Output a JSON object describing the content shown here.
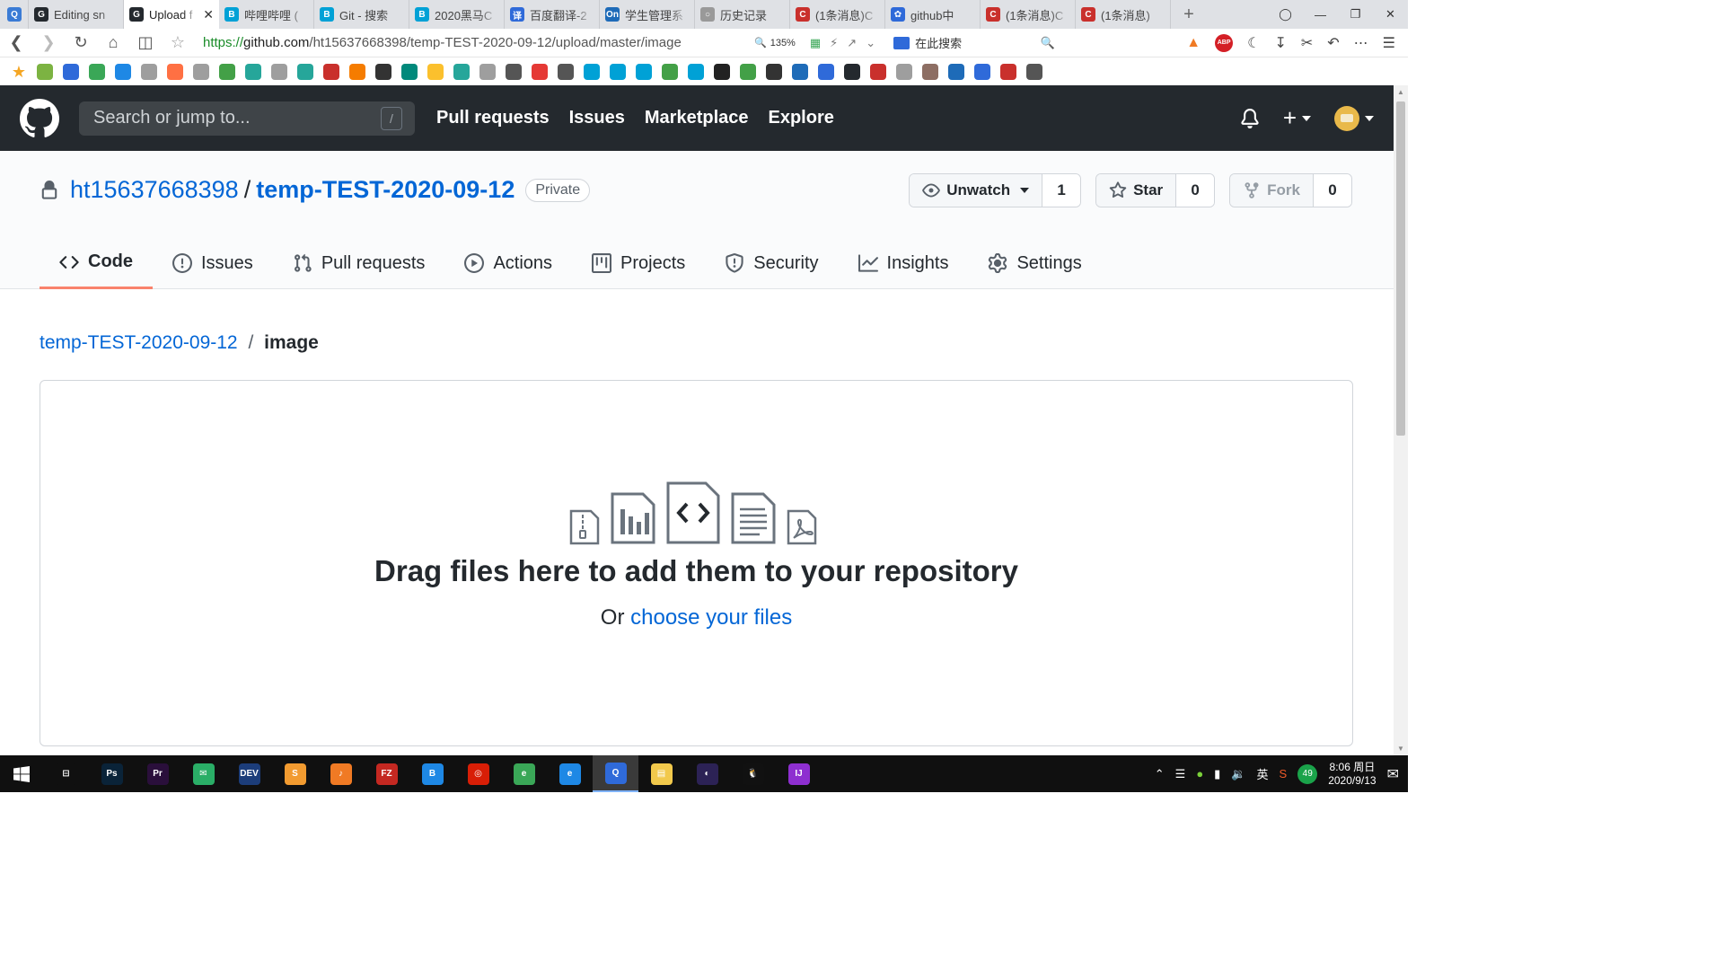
{
  "browser": {
    "tabs": [
      {
        "title": "",
        "color": "#3a7bd5",
        "glyph": "Q"
      },
      {
        "title": "Editing sn",
        "color": "#24292e",
        "glyph": "G"
      },
      {
        "title": "Upload f",
        "color": "#24292e",
        "glyph": "G",
        "active": true
      },
      {
        "title": "哔哩哔哩 (",
        "color": "#00a1d6",
        "glyph": "B"
      },
      {
        "title": "Git - 搜索",
        "color": "#00a1d6",
        "glyph": "B"
      },
      {
        "title": "2020黑马C",
        "color": "#00a1d6",
        "glyph": "B"
      },
      {
        "title": "百度翻译-2",
        "color": "#2f6ad9",
        "glyph": "译"
      },
      {
        "title": "学生管理系",
        "color": "#1e6bb8",
        "glyph": "On"
      },
      {
        "title": "历史记录",
        "color": "#999999",
        "glyph": "○"
      },
      {
        "title": "(1条消息)C",
        "color": "#c9302c",
        "glyph": "C"
      },
      {
        "title": "github中",
        "color": "#2f6ad9",
        "glyph": "✿"
      },
      {
        "title": "(1条消息)C",
        "color": "#c9302c",
        "glyph": "C"
      },
      {
        "title": "(1条消息)",
        "color": "#c9302c",
        "glyph": "C"
      }
    ],
    "close_glyph": "✕",
    "new_tab_glyph": "+",
    "url_scheme": "https://",
    "url_host": "github.com",
    "url_path": "/ht15637668398/temp-TEST-2020-09-12/upload/master/image",
    "zoom": "135%",
    "search_placeholder": "在此搜索"
  },
  "bookmarks": [
    "#f5a623",
    "#7cb342",
    "#2f6ad9",
    "#3aa757",
    "#1e88e5",
    "#9e9e9e",
    "#ff7043",
    "#9e9e9e",
    "#43a047",
    "#26a69a",
    "#9e9e9e",
    "#26a69a",
    "#c9302c",
    "#f57c00",
    "#333333",
    "#00897b",
    "#fbc02d",
    "#26a69a",
    "#9e9e9e",
    "#555555",
    "#e53935",
    "#555555",
    "#00a1d6",
    "#00a1d6",
    "#00a1d6",
    "#43a047",
    "#00a1d6",
    "#222222",
    "#43a047",
    "#333333",
    "#1e6bb8",
    "#2f6ad9",
    "#24292e",
    "#c9302c",
    "#9e9e9e",
    "#8d6e63",
    "#1e6bb8",
    "#2f6ad9",
    "#c9302c",
    "#555555"
  ],
  "github": {
    "search_placeholder": "Search or jump to...",
    "slash": "/",
    "nav": [
      "Pull requests",
      "Issues",
      "Marketplace",
      "Explore"
    ]
  },
  "repo": {
    "owner": "ht15637668398",
    "separator": "/",
    "name": "temp-TEST-2020-09-12",
    "visibility": "Private",
    "watch_label": "Unwatch",
    "watch_count": "1",
    "star_label": "Star",
    "star_count": "0",
    "fork_label": "Fork",
    "fork_count": "0",
    "tabs": [
      "Code",
      "Issues",
      "Pull requests",
      "Actions",
      "Projects",
      "Security",
      "Insights",
      "Settings"
    ],
    "active_tab": "Code"
  },
  "breadcrumb": {
    "repo": "temp-TEST-2020-09-12",
    "separator": "/",
    "dir": "image"
  },
  "dropzone": {
    "title": "Drag files here to add them to your repository",
    "or": "Or",
    "link": "choose your files"
  },
  "taskbar": {
    "apps": [
      {
        "name": "task-view",
        "color": "#101010",
        "glyph": "⊟"
      },
      {
        "name": "photoshop",
        "color": "#0a2338",
        "glyph": "Ps"
      },
      {
        "name": "premiere",
        "color": "#2a0f3b",
        "glyph": "Pr"
      },
      {
        "name": "wechat",
        "color": "#2aae67",
        "glyph": "✉"
      },
      {
        "name": "dev-cpp",
        "color": "#1c3d7a",
        "glyph": "DEV"
      },
      {
        "name": "sublime",
        "color": "#f29b30",
        "glyph": "S"
      },
      {
        "name": "qq-music",
        "color": "#f07a24",
        "glyph": "♪"
      },
      {
        "name": "filezilla",
        "color": "#c42821",
        "glyph": "FZ"
      },
      {
        "name": "bilibili",
        "color": "#1e88e5",
        "glyph": "B"
      },
      {
        "name": "netease-music",
        "color": "#d81e06",
        "glyph": "◎"
      },
      {
        "name": "browser-green",
        "color": "#3aa757",
        "glyph": "e"
      },
      {
        "name": "ie",
        "color": "#1e88e5",
        "glyph": "e"
      },
      {
        "name": "browser-q",
        "color": "#2f6ad9",
        "glyph": "Q",
        "active": true
      },
      {
        "name": "explorer",
        "color": "#f2c94c",
        "glyph": "▤"
      },
      {
        "name": "eclipse",
        "color": "#2c2255",
        "glyph": "◐"
      },
      {
        "name": "qq",
        "color": "#111111",
        "glyph": "🐧"
      },
      {
        "name": "intellij",
        "color": "#8e2fd0",
        "glyph": "IJ"
      }
    ],
    "ime": "英",
    "badge": "49",
    "time": "8:06 周日",
    "date": "2020/9/13"
  }
}
